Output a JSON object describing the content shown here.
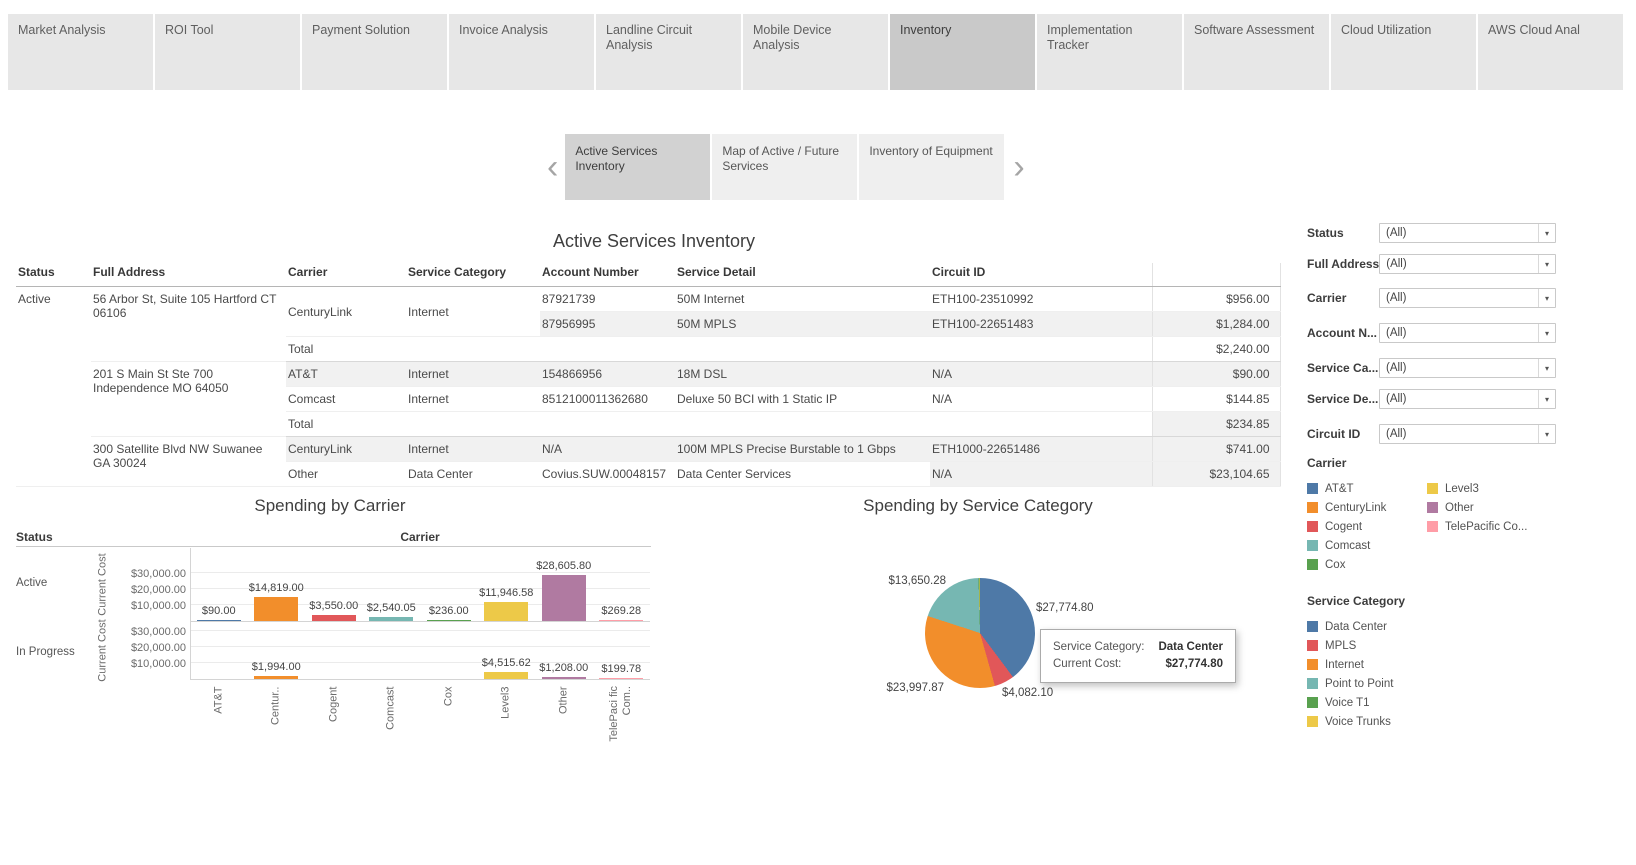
{
  "tabbar": {
    "tabs": [
      {
        "label": "Market Analysis",
        "active": false
      },
      {
        "label": "ROI Tool",
        "active": false
      },
      {
        "label": "Payment Solution",
        "active": false
      },
      {
        "label": "Invoice Analysis",
        "active": false
      },
      {
        "label": "Landline Circuit Analysis",
        "active": false
      },
      {
        "label": "Mobile Device Analysis",
        "active": false
      },
      {
        "label": "Inventory",
        "active": true
      },
      {
        "label": "Implementation Tracker",
        "active": false
      },
      {
        "label": "Software Assessment",
        "active": false
      },
      {
        "label": "Cloud Utilization",
        "active": false
      },
      {
        "label": "AWS Cloud Anal",
        "active": false
      }
    ]
  },
  "storynav": {
    "prev_icon": "‹",
    "next_icon": "›",
    "points": [
      {
        "label": "Active Services Inventory",
        "active": true
      },
      {
        "label": "Map of Active / Future Services",
        "active": false
      },
      {
        "label": "Inventory of Equipment",
        "active": false
      }
    ]
  },
  "inventory_table": {
    "title": "Active Services Inventory",
    "headers": {
      "status": "Status",
      "address": "Full Address",
      "carrier": "Carrier",
      "category": "Service Category",
      "account": "Account Number",
      "detail": "Service Detail",
      "circuit": "Circuit ID"
    },
    "rows": [
      {
        "status": "Active",
        "address": "56 Arbor St, Suite 105 Hartford CT 06106",
        "carrier": "CenturyLink",
        "category": "Internet",
        "account": "87921739",
        "detail": "50M Internet",
        "circuit": "ETH100-23510992",
        "cost": "$956.00"
      },
      {
        "account": "87956995",
        "detail": "50M MPLS",
        "circuit": "ETH100-22651483",
        "cost": "$1,284.00"
      },
      {
        "label": "Total",
        "cost": "$2,240.00"
      },
      {
        "address": "201 S Main St Ste 700 Independence MO 64050",
        "carrier": "AT&T",
        "category": "Internet",
        "account": "154866956",
        "detail": "18M DSL",
        "circuit": "N/A",
        "cost": "$90.00"
      },
      {
        "carrier": "Comcast",
        "category": "Internet",
        "account": "8512100011362680",
        "detail": "Deluxe 50 BCI with 1 Static IP",
        "circuit": "N/A",
        "cost": "$144.85"
      },
      {
        "label": "Total",
        "cost": "$234.85"
      },
      {
        "address": "300 Satellite Blvd NW Suwanee GA 30024",
        "carrier": "CenturyLink",
        "category": "Internet",
        "account": "N/A",
        "detail": "100M MPLS Precise Burstable to 1 Gbps",
        "circuit": "ETH1000-22651486",
        "cost": "$741.00"
      },
      {
        "carrier": "Other",
        "category": "Data Center",
        "account": "Covius.SUW.00048157",
        "detail": "Data Center Services",
        "circuit": "N/A",
        "cost": "$23,104.65"
      }
    ]
  },
  "filters": {
    "items": [
      {
        "label": "Status",
        "value": "(All)"
      },
      {
        "label": "Full Address",
        "value": "(All)"
      },
      {
        "label": "Carrier",
        "value": "(All)"
      },
      {
        "label": "Account N...",
        "value": "(All)"
      },
      {
        "label": "Service Ca...",
        "value": "(All)"
      },
      {
        "label": "Service De...",
        "value": "(All)"
      },
      {
        "label": "Circuit ID",
        "value": "(All)"
      }
    ]
  },
  "legend_carrier": {
    "title": "Carrier",
    "items": [
      {
        "label": "AT&T",
        "color": "#4e79a7"
      },
      {
        "label": "CenturyLink",
        "color": "#f28e2b"
      },
      {
        "label": "Cogent",
        "color": "#e15759"
      },
      {
        "label": "Comcast",
        "color": "#76b7b2"
      },
      {
        "label": "Cox",
        "color": "#59a14f"
      },
      {
        "label": "Level3",
        "color": "#edc948"
      },
      {
        "label": "Other",
        "color": "#b07aa1"
      },
      {
        "label": "TelePacific Co...",
        "color": "#ff9da7"
      }
    ]
  },
  "legend_service": {
    "title": "Service Category",
    "items": [
      {
        "label": "Data Center",
        "color": "#4e79a7"
      },
      {
        "label": "MPLS",
        "color": "#e15759"
      },
      {
        "label": "Internet",
        "color": "#f28e2b"
      },
      {
        "label": "Point to Point",
        "color": "#76b7b2"
      },
      {
        "label": "Voice T1",
        "color": "#59a14f"
      },
      {
        "label": "Voice Trunks",
        "color": "#edc948"
      }
    ]
  },
  "chart_data": [
    {
      "type": "bar",
      "title": "Spending by Carrier",
      "row_header": "Status",
      "col_header": "Carrier",
      "ylabel": "Current Cost",
      "yticks": [
        "$30,000.00",
        "$20,000.00",
        "$10,000.00"
      ],
      "ylim": [
        0,
        30000
      ],
      "grid": true,
      "categories": [
        "AT&T",
        "Centur..",
        "Cogent",
        "Comcast",
        "Cox",
        "Level3",
        "Other",
        "TelePaci fic Com.."
      ],
      "colors": [
        "#4e79a7",
        "#f28e2b",
        "#e15759",
        "#76b7b2",
        "#59a14f",
        "#edc948",
        "#b07aa1",
        "#ff9da7"
      ],
      "series": [
        {
          "name": "Active",
          "values": [
            90,
            14819,
            3550,
            2540.05,
            236,
            11946.58,
            28605.8,
            269.28
          ],
          "labels": [
            "$90.00",
            "$14,819.00",
            "$3,550.00",
            "$2,540.05",
            "$236.00",
            "$11,946.58",
            "$28,605.80",
            "$269.28"
          ]
        },
        {
          "name": "In Progress",
          "values": [
            0,
            1994,
            0,
            0,
            0,
            4515.62,
            1208,
            199.78
          ],
          "labels": [
            "",
            "$1,994.00",
            "",
            "",
            "",
            "$4,515.62",
            "$1,208.00",
            "$199.78"
          ]
        }
      ]
    },
    {
      "type": "pie",
      "title": "Spending by Service Category",
      "slices": [
        {
          "label": "Data Center",
          "value": 27774.8,
          "color": "#4e79a7",
          "display": "$27,774.80"
        },
        {
          "label": "MPLS",
          "value": 4082.1,
          "color": "#e15759",
          "display": "$4,082.10"
        },
        {
          "label": "Internet",
          "value": 23997.87,
          "color": "#f28e2b",
          "display": "$23,997.87"
        },
        {
          "label": "Point to Point",
          "value": 13650.28,
          "color": "#76b7b2",
          "display": "$13,650.28"
        },
        {
          "label": "Voice T1",
          "value": 200,
          "color": "#59a14f",
          "display": ""
        },
        {
          "label": "Voice Trunks",
          "value": 120,
          "color": "#edc948",
          "display": ""
        }
      ],
      "tooltip": {
        "line1_label": "Service Category:",
        "line1_value": "Data Center",
        "line2_label": "Current Cost:",
        "line2_value": "$27,774.80"
      }
    }
  ]
}
